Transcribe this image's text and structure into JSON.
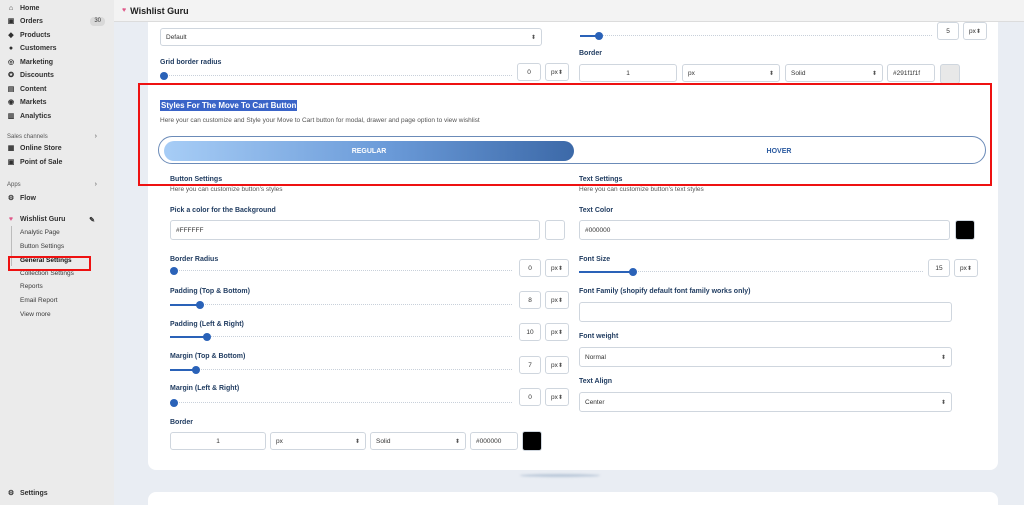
{
  "sidebar": {
    "items": [
      {
        "label": "Home",
        "icon": "home-icon",
        "glyph": "⌂"
      },
      {
        "label": "Orders",
        "icon": "orders-icon",
        "glyph": "▣",
        "badge": "30"
      },
      {
        "label": "Products",
        "icon": "tag-icon",
        "glyph": "◆"
      },
      {
        "label": "Customers",
        "icon": "person-icon",
        "glyph": "●"
      },
      {
        "label": "Marketing",
        "icon": "target-icon",
        "glyph": "◎"
      },
      {
        "label": "Discounts",
        "icon": "discount-icon",
        "glyph": "✪"
      },
      {
        "label": "Content",
        "icon": "content-icon",
        "glyph": "▤"
      },
      {
        "label": "Markets",
        "icon": "globe-icon",
        "glyph": "◉"
      },
      {
        "label": "Analytics",
        "icon": "chart-icon",
        "glyph": "▥"
      }
    ],
    "sales_channels_label": "Sales channels",
    "channels": [
      {
        "label": "Online Store",
        "icon": "store-icon",
        "glyph": "▦"
      },
      {
        "label": "Point of Sale",
        "icon": "pos-icon",
        "glyph": "▣"
      }
    ],
    "apps_label": "Apps",
    "flow_label": "Flow",
    "wishlist_label": "Wishlist Guru",
    "wishlist_sub": [
      {
        "label": "Analytic Page"
      },
      {
        "label": "Button Settings"
      },
      {
        "label": "General Settings",
        "active": true
      },
      {
        "label": "Collection Settings"
      },
      {
        "label": "Reports"
      },
      {
        "label": "Email Report"
      },
      {
        "label": "View more"
      }
    ],
    "settings_label": "Settings"
  },
  "header": {
    "title": "Wishlist Guru"
  },
  "top": {
    "default_select": "Default",
    "grid_border_radius_label": "Grid border radius",
    "grid_radius_value": "0",
    "grid_radius_unit": "px",
    "right_slider_value": "5",
    "right_slider_unit": "px",
    "border_label": "Border",
    "border_width": "1",
    "border_unit": "px",
    "border_style": "Solid",
    "border_color": "#291f1f1f"
  },
  "section": {
    "title": "Styles For The Move To Cart Button",
    "description": "Here your can customize and Style your Move to Cart button for modal, drawer and page option to view wishlist",
    "tab_regular": "REGULAR",
    "tab_hover": "HOVER"
  },
  "button_settings": {
    "title": "Button Settings",
    "subtitle": "Here you can customize button's styles",
    "bg_label": "Pick a color for the Background",
    "bg_value": "#FFFFFF",
    "radius_label": "Border Radius",
    "radius_value": "0",
    "padding_tb_label": "Padding (Top & Bottom)",
    "padding_tb_value": "8",
    "padding_lr_label": "Padding (Left & Right)",
    "padding_lr_value": "10",
    "margin_tb_label": "Margin (Top & Bottom)",
    "margin_tb_value": "7",
    "margin_lr_label": "Margin (Left & Right)",
    "margin_lr_value": "0",
    "unit": "px",
    "border_label": "Border",
    "border_width": "1",
    "border_unit": "px",
    "border_style": "Solid",
    "border_color": "#000000"
  },
  "text_settings": {
    "title": "Text Settings",
    "subtitle": "Here you can customize button's text styles",
    "color_label": "Text Color",
    "color_value": "#000000",
    "font_size_label": "Font Size",
    "font_size_value": "15",
    "font_size_unit": "px",
    "font_family_label": "Font Family (shopify default font family works only)",
    "font_family_value": "",
    "font_weight_label": "Font weight",
    "font_weight_value": "Normal",
    "text_align_label": "Text Align",
    "text_align_value": "Center"
  },
  "colors": {
    "accent": "#2a62b8",
    "highlight_red": "#ee1111",
    "black": "#000000"
  }
}
